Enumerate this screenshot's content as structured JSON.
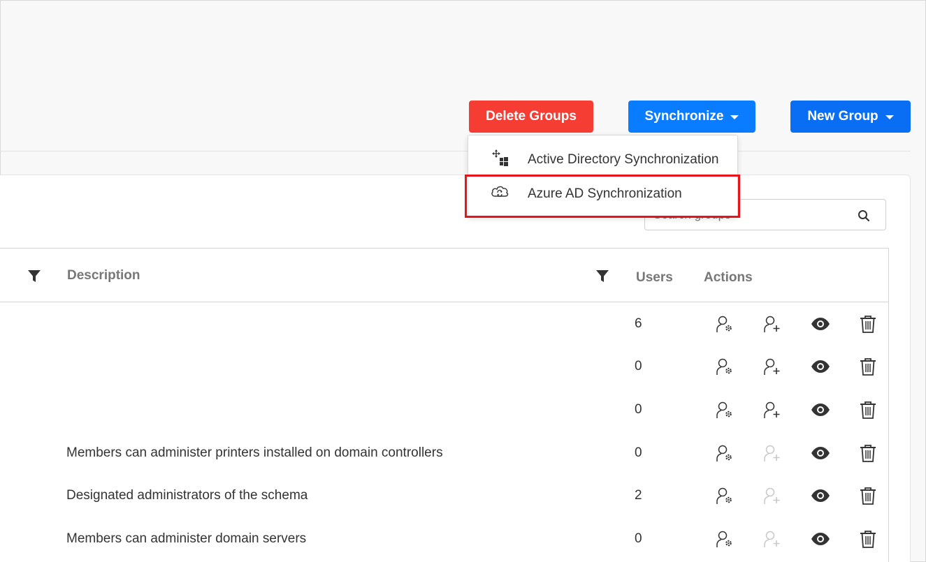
{
  "toolbar": {
    "delete_label": "Delete Groups",
    "sync_label": "Synchronize",
    "new_label": "New Group"
  },
  "sync_menu": {
    "items": [
      {
        "label": "Active Directory Synchronization",
        "icon": "ad-sync-icon"
      },
      {
        "label": "Azure AD Synchronization",
        "icon": "cloud-sync-icon",
        "highlighted": true
      }
    ]
  },
  "search": {
    "placeholder": "Search groups"
  },
  "table": {
    "headers": {
      "description": "Description",
      "users": "Users",
      "actions": "Actions"
    },
    "rows": [
      {
        "description": "",
        "users": "6",
        "add_enabled": true
      },
      {
        "description": "",
        "users": "0",
        "add_enabled": true
      },
      {
        "description": "",
        "users": "0",
        "add_enabled": true
      },
      {
        "description": "Members can administer printers installed on domain controllers",
        "users": "0",
        "add_enabled": false
      },
      {
        "description": "Designated administrators of the schema",
        "users": "2",
        "add_enabled": false
      },
      {
        "description": "Members can administer domain servers",
        "users": "0",
        "add_enabled": false
      }
    ]
  },
  "colors": {
    "delete": "#f53d34",
    "primary": "#0a7cff",
    "highlight": "#e8141b"
  }
}
